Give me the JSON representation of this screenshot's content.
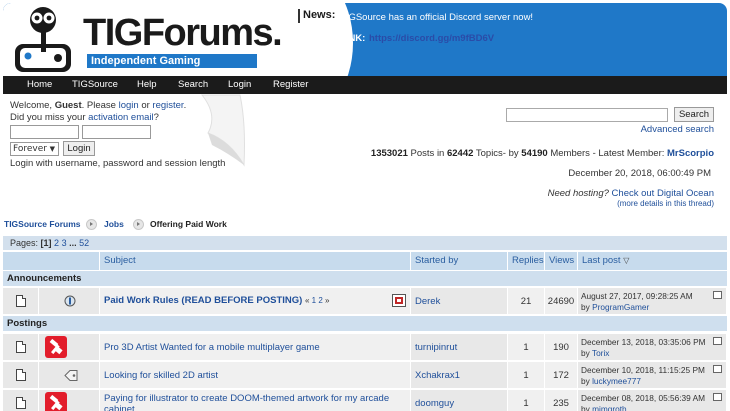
{
  "header": {
    "logo_title": "TIGForums.",
    "logo_tagline": "Independent Gaming Discussion.",
    "news_label": "News:",
    "news_text": "TIGSource has an official Discord server now!",
    "news_link_label": "LINK:",
    "news_link_url": "https://discord.gg/m9fBD6V",
    "colors": {
      "header_blue": "#1f78c8",
      "nav_black": "#1b1b1b"
    }
  },
  "nav": {
    "items": [
      "Home",
      "TIGSource",
      "Help",
      "Search",
      "Login",
      "Register"
    ]
  },
  "login": {
    "welcome_prefix": "Welcome, ",
    "guest": "Guest",
    "please": ". Please ",
    "login_link": "login",
    "or": " or ",
    "register_link": "register",
    "period": ".",
    "missed_prefix": "Did you miss your ",
    "activation_link": "activation email",
    "question": "?",
    "duration_selected": "Forever",
    "login_button": "Login",
    "session_hint": "Login with username, password and session length"
  },
  "search": {
    "button": "Search",
    "advanced_link": "Advanced search"
  },
  "stats": {
    "posts": "1353021",
    "posts_label": " Posts in ",
    "topics": "62442",
    "topics_label": " Topics- by ",
    "members": "54190",
    "members_label": " Members - Latest Member: ",
    "latest_member": "MrScorpio",
    "date": "December 20, 2018, 06:00:49 PM",
    "hosting_question": "Need hosting?",
    "hosting_link": "Check out Digital Ocean",
    "hosting_more": "(more details in this thread)"
  },
  "breadcrumb": {
    "items": [
      "TIGSource Forums",
      "Jobs",
      "Offering Paid Work"
    ]
  },
  "pages": {
    "label": "Pages: ",
    "current": "[1]",
    "links": [
      "2",
      "3",
      "...",
      "52"
    ]
  },
  "table": {
    "headers": {
      "subject": "Subject",
      "started_by": "Started by",
      "replies": "Replies",
      "views": "Views",
      "last_post": "Last post"
    },
    "sections": {
      "announcements": "Announcements",
      "postings": "Postings"
    },
    "announcement": {
      "subject": "Paid Work Rules (READ BEFORE POSTING)",
      "pages_open": "«",
      "page1": "1",
      "page2": "2",
      "pages_close": "»",
      "starter": "Derek",
      "replies": "21",
      "views": "24690",
      "last_date": "August 27, 2017, 09:28:25 AM",
      "by": "by ",
      "last_user": "ProgramGamer"
    },
    "rows": [
      {
        "subject": "Pro 3D Artist Wanted for a mobile multiplayer game",
        "starter": "turnipinrut",
        "replies": "1",
        "views": "190",
        "last_date": "December 13, 2018, 03:35:06 PM",
        "by": "by ",
        "last_user": "Torix"
      },
      {
        "subject": "Looking for skilled 2D artist",
        "starter": "Xchakrax1",
        "replies": "1",
        "views": "172",
        "last_date": "December 10, 2018, 11:15:25 PM",
        "by": "by ",
        "last_user": "luckymee777"
      },
      {
        "subject": "Paying for illustrator to create DOOM-themed artwork for my arcade cabinet",
        "starter": "doomguy",
        "replies": "1",
        "views": "235",
        "last_date": "December 08, 2018, 05:56:39 AM",
        "by": "by ",
        "last_user": "mimgroth"
      }
    ]
  }
}
